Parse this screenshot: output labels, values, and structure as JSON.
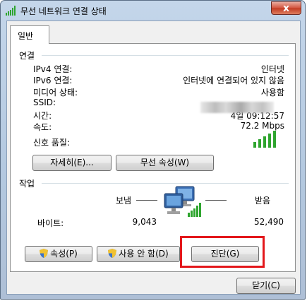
{
  "window": {
    "title": "무선 네트워크 연결 상태",
    "close_label": "x"
  },
  "tabs": [
    {
      "label": "일반"
    }
  ],
  "connection": {
    "group_label": "연결",
    "rows": [
      {
        "label": "IPv4 연결:",
        "value": "인터넷"
      },
      {
        "label": "IPv6 연결:",
        "value": "인터넷에 연결되어 있지 않음"
      },
      {
        "label": "미디어 상태:",
        "value": "사용함"
      },
      {
        "label": "SSID:",
        "value": ""
      },
      {
        "label": "시간:",
        "value": "4일 09:12:57"
      },
      {
        "label": "속도:",
        "value": "72.2 Mbps"
      }
    ],
    "signal_label": "신호 품질:",
    "signal_bars": 5
  },
  "buttons": {
    "details": "자세히(E)...",
    "wireless_props": "무선 속성(W)",
    "properties": "속성(P)",
    "disable": "사용 안 함(D)",
    "diagnose": "진단(G)",
    "close": "닫기(C)"
  },
  "activity": {
    "group_label": "작업",
    "sent_label": "보냄",
    "received_label": "받음",
    "bytes_label": "바이트:",
    "bytes_sent": "9,043",
    "bytes_received": "52,490"
  },
  "colors": {
    "signal_green": "#2fa52f",
    "highlight": "#e3171b"
  }
}
